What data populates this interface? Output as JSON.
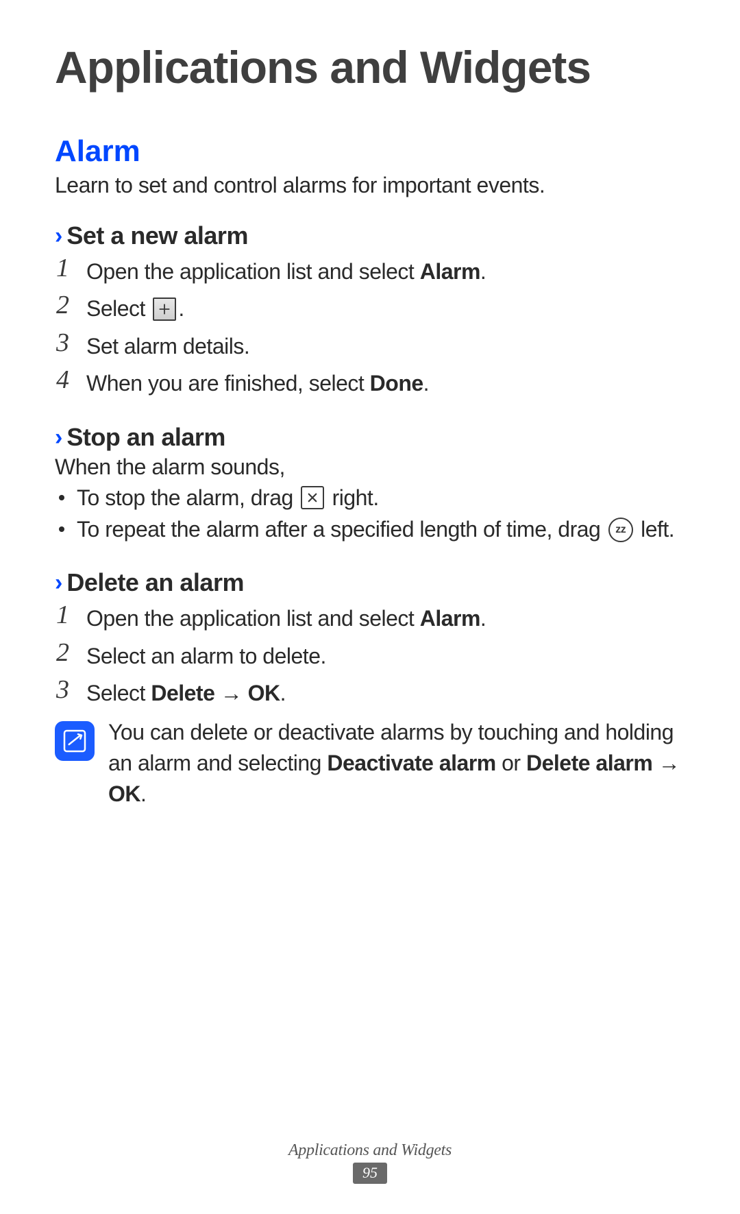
{
  "heading": "Applications and Widgets",
  "section": {
    "title": "Alarm",
    "intro": "Learn to set and control alarms for important events."
  },
  "sub1": {
    "title": "Set a new alarm",
    "steps": {
      "s1_pre": "Open the application list and select ",
      "s1_bold": "Alarm",
      "s1_post": ".",
      "s2_pre": "Select ",
      "s2_post": ".",
      "s3": "Set alarm details.",
      "s4_pre": "When you are finished, select ",
      "s4_bold": "Done",
      "s4_post": "."
    }
  },
  "sub2": {
    "title": "Stop an alarm",
    "lead": "When the alarm sounds,",
    "b1_pre": "To stop the alarm, drag ",
    "b1_post": " right.",
    "b2_pre": "To repeat the alarm after a specified length of time, drag ",
    "b2_post": " left."
  },
  "sub3": {
    "title": "Delete an alarm",
    "steps": {
      "s1_pre": "Open the application list and select ",
      "s1_bold": "Alarm",
      "s1_post": ".",
      "s2": "Select an alarm to delete.",
      "s3_pre": "Select ",
      "s3_b1": "Delete",
      "s3_mid": " → ",
      "s3_b2": "OK",
      "s3_post": "."
    },
    "note_pre": "You can delete or deactivate alarms by touching and holding an alarm and selecting ",
    "note_b1": "Deactivate alarm",
    "note_mid1": " or ",
    "note_b2": "Delete alarm",
    "note_mid2": " → ",
    "note_b3": "OK",
    "note_post": "."
  },
  "nums": {
    "n1": "1",
    "n2": "2",
    "n3": "3",
    "n4": "4"
  },
  "icons": {
    "snooze_text": "zz"
  },
  "footer": {
    "title": "Applications and Widgets",
    "page": "95"
  }
}
